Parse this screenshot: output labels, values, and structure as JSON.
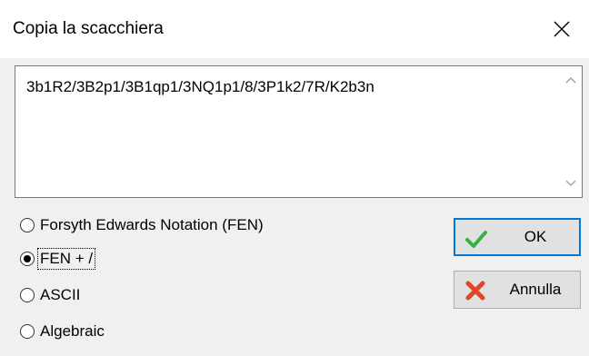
{
  "dialog": {
    "title": "Copia la scacchiera",
    "close_icon": "close-icon"
  },
  "textbox": {
    "value": "3b1R2/3B2p1/3B1qp1/3NQ1p1/8/3P1k2/7R/K2b3n"
  },
  "format_options": [
    {
      "label": "Forsyth Edwards Notation (FEN)",
      "selected": false
    },
    {
      "label": "FEN + /",
      "selected": true
    },
    {
      "label": "ASCII",
      "selected": false
    },
    {
      "label": "Algebraic",
      "selected": false
    }
  ],
  "buttons": {
    "ok_label": "OK",
    "ok_icon": "checkmark-icon",
    "cancel_label": "Annulla",
    "cancel_icon": "red-x-icon"
  },
  "colors": {
    "accent": "#0078d7",
    "ok_icon": "#3cb043",
    "cancel_icon": "#e0452a"
  }
}
